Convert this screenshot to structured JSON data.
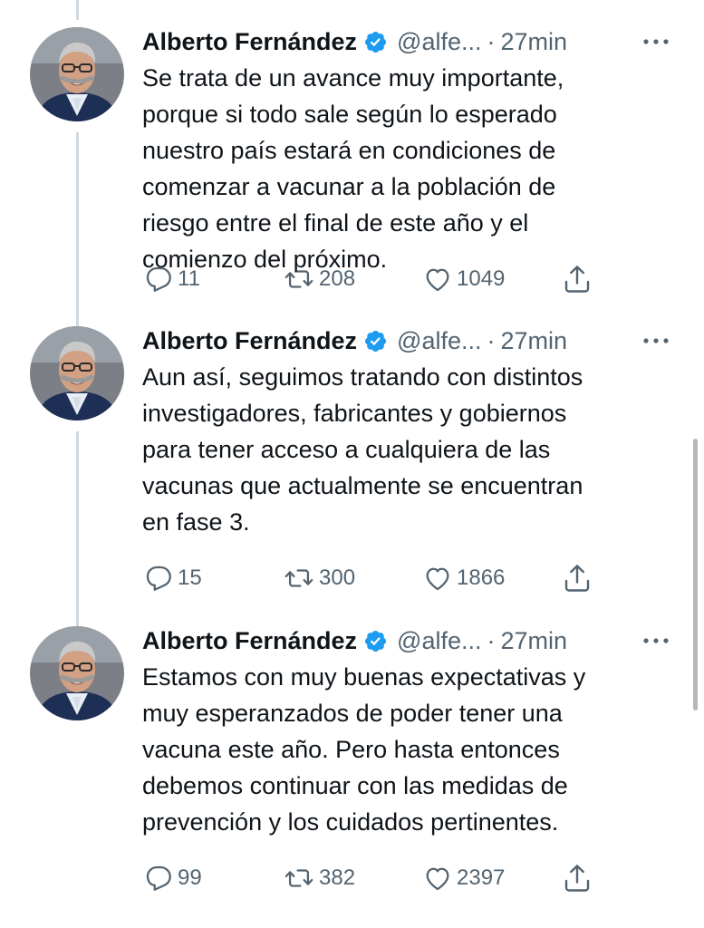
{
  "colors": {
    "text": "#0f1419",
    "secondary": "#536471",
    "verified": "#1d9bf0",
    "thread_line": "#cfd9de"
  },
  "tweets": [
    {
      "name": "Alberto Fernández",
      "handle": "@alfe...",
      "separator": "·",
      "time": "27min",
      "body": [
        "Se trata de un avance muy importante,",
        "porque si todo sale según lo esperado",
        "nuestro país estará en condiciones de",
        "comenzar a vacunar a la población de",
        "riesgo entre el final de este año y el",
        "comienzo del próximo."
      ],
      "replies": "11",
      "retweets": "208",
      "likes": "1049"
    },
    {
      "name": "Alberto Fernández",
      "handle": "@alfe...",
      "separator": "·",
      "time": "27min",
      "body": [
        "Aun así, seguimos tratando con distintos",
        "investigadores, fabricantes y gobiernos",
        "para tener acceso a cualquiera de las",
        "vacunas que actualmente se encuentran",
        "en fase 3."
      ],
      "replies": "15",
      "retweets": "300",
      "likes": "1866"
    },
    {
      "name": "Alberto Fernández",
      "handle": "@alfe...",
      "separator": "·",
      "time": "27min",
      "body": [
        "Estamos con muy buenas expectativas y",
        "muy esperanzados de poder tener una",
        "vacuna este año. Pero hasta entonces",
        "debemos continuar con las medidas de",
        "prevención y los cuidados pertinentes."
      ],
      "replies": "99",
      "retweets": "382",
      "likes": "2397"
    }
  ],
  "icons": {
    "verified": "verified-badge-icon",
    "more": "more-options-icon",
    "reply": "reply-icon",
    "retweet": "retweet-icon",
    "like": "heart-icon",
    "share": "share-icon"
  }
}
